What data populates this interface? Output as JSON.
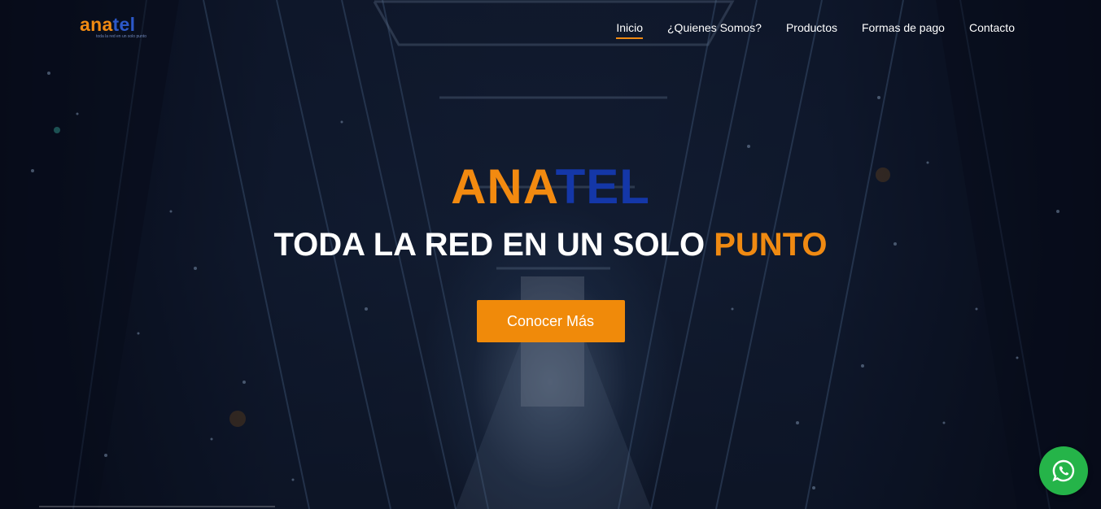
{
  "header": {
    "logo": {
      "part1": "ana",
      "part2": "tel",
      "tagline": "toda la red en un solo punto"
    },
    "nav": [
      {
        "label": "Inicio",
        "active": true
      },
      {
        "label": "¿Quienes Somos?",
        "active": false
      },
      {
        "label": "Productos",
        "active": false
      },
      {
        "label": "Formas de pago",
        "active": false
      },
      {
        "label": "Contacto",
        "active": false
      }
    ]
  },
  "hero": {
    "brand_part1": "ANA",
    "brand_part2": "TEL",
    "tagline_main": "TODA LA RED EN UN SOLO ",
    "tagline_accent": "PUNTO",
    "cta_label": "Conocer Más"
  },
  "floating": {
    "whatsapp_icon": "whatsapp-icon"
  },
  "colors": {
    "accent_orange": "#f08a12",
    "brand_blue": "#1437a8",
    "whatsapp_green": "#25b449"
  }
}
